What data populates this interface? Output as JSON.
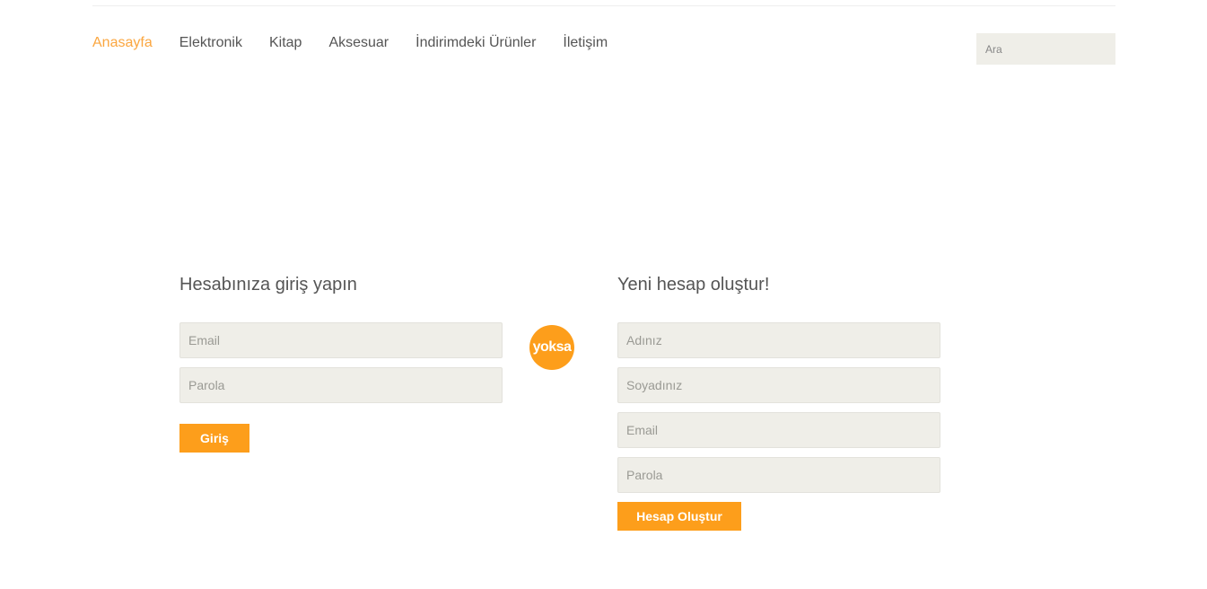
{
  "nav": {
    "items": [
      {
        "label": "Anasayfa",
        "active": true
      },
      {
        "label": "Elektronik"
      },
      {
        "label": "Kitap"
      },
      {
        "label": "Aksesuar"
      },
      {
        "label": "İndirimdeki Ürünler"
      },
      {
        "label": "İletişim"
      }
    ]
  },
  "search": {
    "placeholder": "Ara"
  },
  "login": {
    "title": "Hesabınıza giriş yapın",
    "email_placeholder": "Email",
    "password_placeholder": "Parola",
    "submit_label": "Giriş"
  },
  "divider": {
    "label": "yoksa"
  },
  "register": {
    "title": "Yeni hesap oluştur!",
    "first_name_placeholder": "Adınız",
    "last_name_placeholder": "Soyadınız",
    "email_placeholder": "Email",
    "password_placeholder": "Parola",
    "submit_label": "Hesap Oluştur"
  },
  "colors": {
    "accent": "#fd9e1b",
    "nav_active": "#fba63f",
    "field_bg": "#efeee8",
    "text": "#555555"
  }
}
